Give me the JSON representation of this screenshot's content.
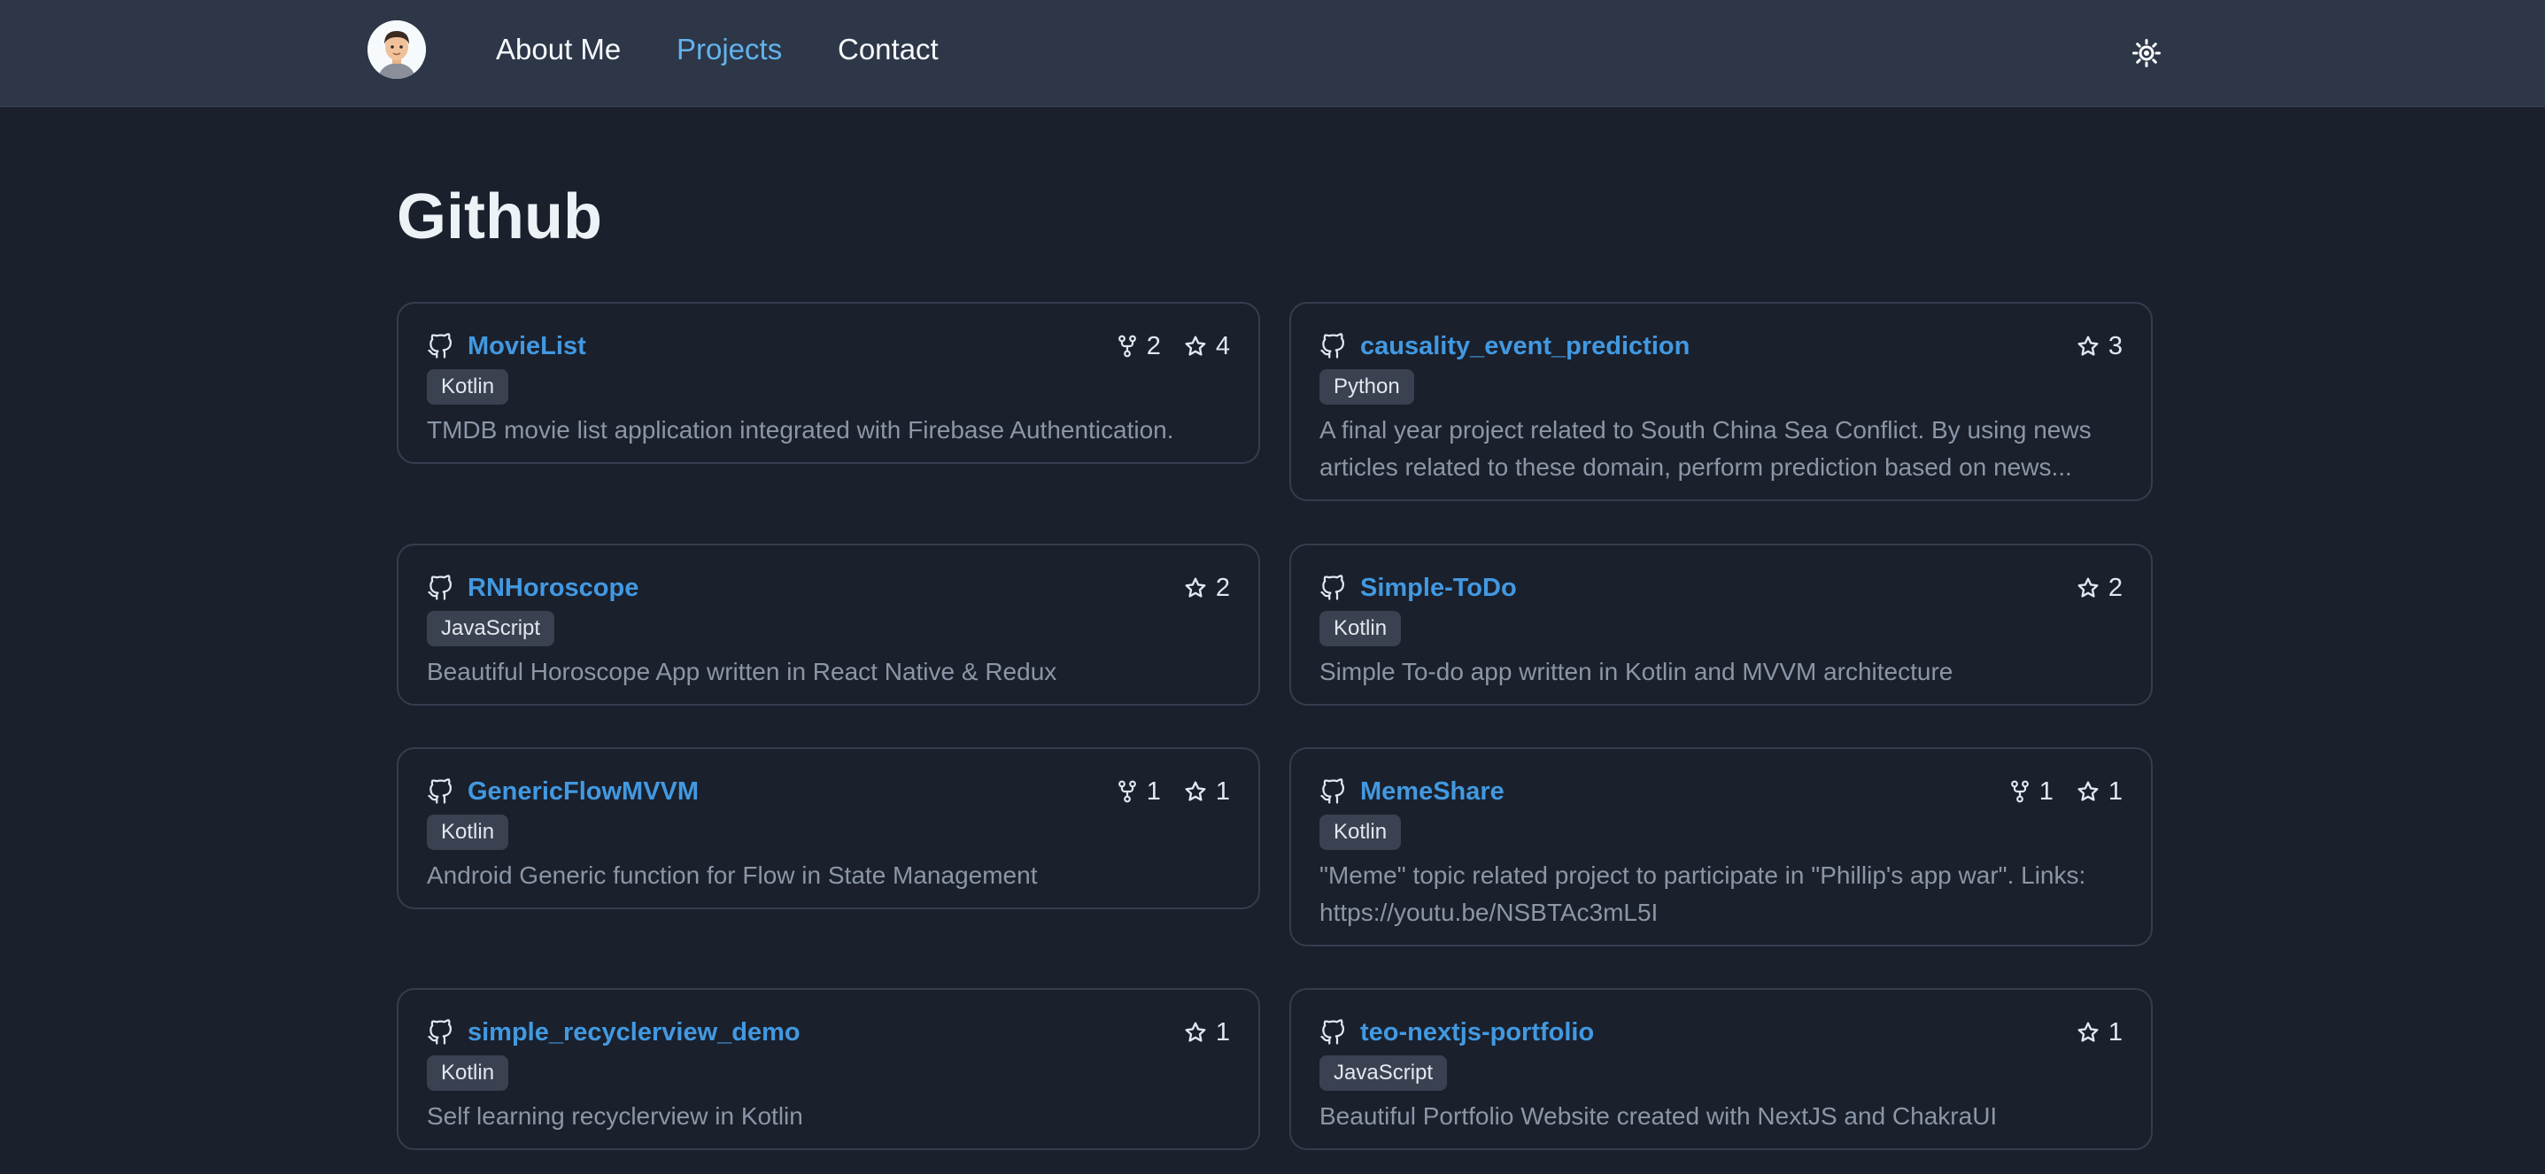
{
  "nav": {
    "links": [
      {
        "label": "About Me",
        "active": false
      },
      {
        "label": "Projects",
        "active": true
      },
      {
        "label": "Contact",
        "active": false
      }
    ]
  },
  "page": {
    "title": "Github"
  },
  "colors": {
    "background": "#1a202c",
    "navbar": "#2d3748",
    "accent": "#4299e1",
    "active_link": "#63b3ed",
    "badge": "#3a4150",
    "description": "#8b96a6"
  },
  "repos": [
    {
      "name": "MovieList",
      "language": "Kotlin",
      "forks": "2",
      "stars": "4",
      "description": "TMDB movie list application integrated with Firebase Authentication."
    },
    {
      "name": "causality_event_prediction",
      "language": "Python",
      "forks": null,
      "stars": "3",
      "description": "A final year project related to South China Sea Conflict. By using news articles related to these domain, perform prediction based on news..."
    },
    {
      "name": "RNHoroscope",
      "language": "JavaScript",
      "forks": null,
      "stars": "2",
      "description": "Beautiful Horoscope App written in React Native & Redux"
    },
    {
      "name": "Simple-ToDo",
      "language": "Kotlin",
      "forks": null,
      "stars": "2",
      "description": "Simple To-do app written in Kotlin and MVVM architecture"
    },
    {
      "name": "GenericFlowMVVM",
      "language": "Kotlin",
      "forks": "1",
      "stars": "1",
      "description": "Android Generic function for Flow in State Management"
    },
    {
      "name": "MemeShare",
      "language": "Kotlin",
      "forks": "1",
      "stars": "1",
      "description": "\"Meme\" topic related project to participate in \"Phillip's app war\". Links: https://youtu.be/NSBTAc3mL5I"
    },
    {
      "name": "simple_recyclerview_demo",
      "language": "Kotlin",
      "forks": null,
      "stars": "1",
      "description": "Self learning recyclerview in Kotlin"
    },
    {
      "name": "teo-nextjs-portfolio",
      "language": "JavaScript",
      "forks": null,
      "stars": "1",
      "description": "Beautiful Portfolio Website created with NextJS and ChakraUI"
    }
  ]
}
